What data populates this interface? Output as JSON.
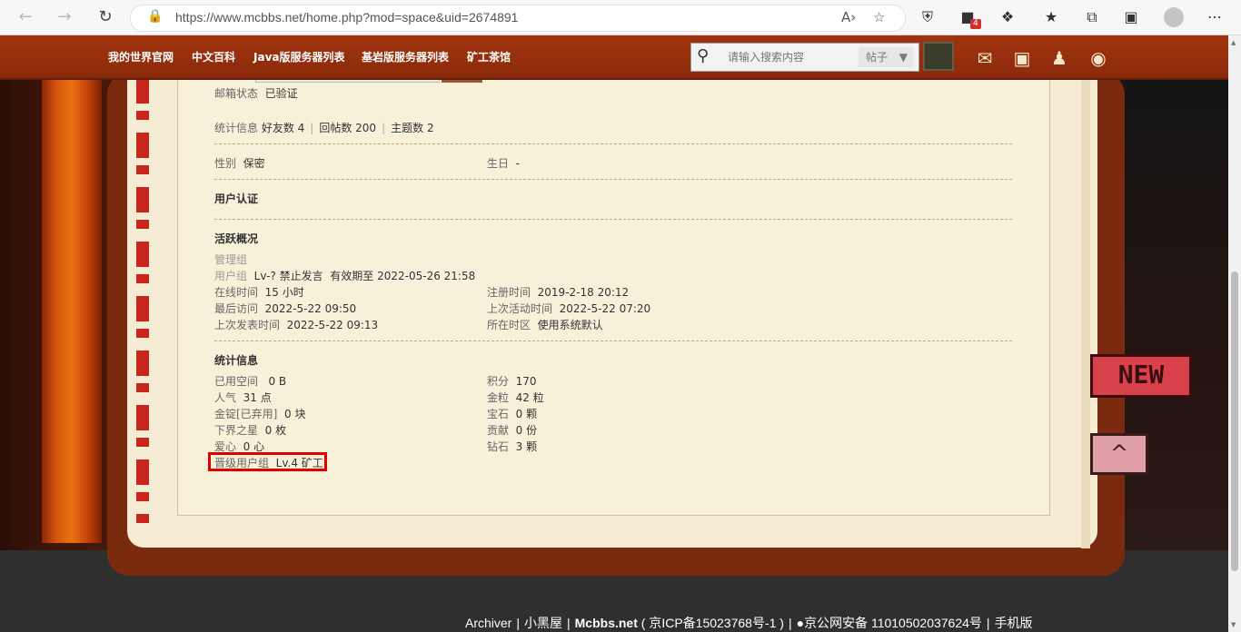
{
  "browser": {
    "url": "https://www.mcbbs.net/home.php?mod=space&uid=2674891",
    "extension_badge": "4"
  },
  "site_nav": {
    "links": [
      "我的世界官网",
      "中文百科",
      "Java版服务器列表",
      "基岩版服务器列表",
      "矿工茶馆"
    ],
    "search_placeholder": "请输入搜索内容",
    "search_type": "帖子"
  },
  "profile": {
    "email_label": "邮箱状态",
    "email_value": "已验证",
    "stats_line_label": "统计信息",
    "friends": "好友数 4",
    "replies": "回帖数 200",
    "threads": "主题数 2",
    "gender_label": "性别",
    "gender_value": "保密",
    "birthday_label": "生日",
    "birthday_value": "-",
    "cert_title": "用户认证",
    "activity_title": "活跃概况",
    "admin_group": "管理组",
    "group_label": "用户组",
    "group_value": "Lv-? 禁止发言",
    "group_expiry": "有效期至 2022-05-26 21:58",
    "online_label": "在线时间",
    "online_value": "15 小时",
    "register_label": "注册时间",
    "register_value": "2019-2-18 20:12",
    "last_visit_label": "最后访问",
    "last_visit_value": "2022-5-22 09:50",
    "last_active_label": "上次活动时间",
    "last_active_value": "2022-5-22 07:20",
    "last_post_label": "上次发表时间",
    "last_post_value": "2022-5-22 09:13",
    "timezone_label": "所在时区",
    "timezone_value": "使用系统默认",
    "stats_title": "统计信息",
    "space_label": "已用空间",
    "space_value": "0 B",
    "points_label": "积分",
    "points_value": "170",
    "popularity_label": "人气",
    "popularity_value": "31 点",
    "gold_label": "金粒",
    "gold_value": "42 粒",
    "ingot_label": "金锭[已弃用]",
    "ingot_value": "0 块",
    "gem_label": "宝石",
    "gem_value": "0 颗",
    "nether_label": "下界之星",
    "nether_value": "0 枚",
    "contrib_label": "贡献",
    "contrib_value": "0 份",
    "love_label": "爱心",
    "love_value": "0 心",
    "diamond_label": "钻石",
    "diamond_value": "3 颗",
    "promote_label": "晋级用户组",
    "promote_value": "Lv.4 矿工"
  },
  "flags": {
    "new_label": "NEW",
    "top_label": "^"
  },
  "footer": {
    "archiver": "Archiver",
    "blackroom": "小黑屋",
    "site": "Mcbbs.net",
    "icp": "( 京ICP备15023768号-1 )",
    "police": "京公网安备 11010502037624号",
    "mobile": "手机版"
  },
  "colors": {
    "site_bar": "#a2340f",
    "page_bg": "#f5ecd3",
    "highlight": "#e00000"
  }
}
